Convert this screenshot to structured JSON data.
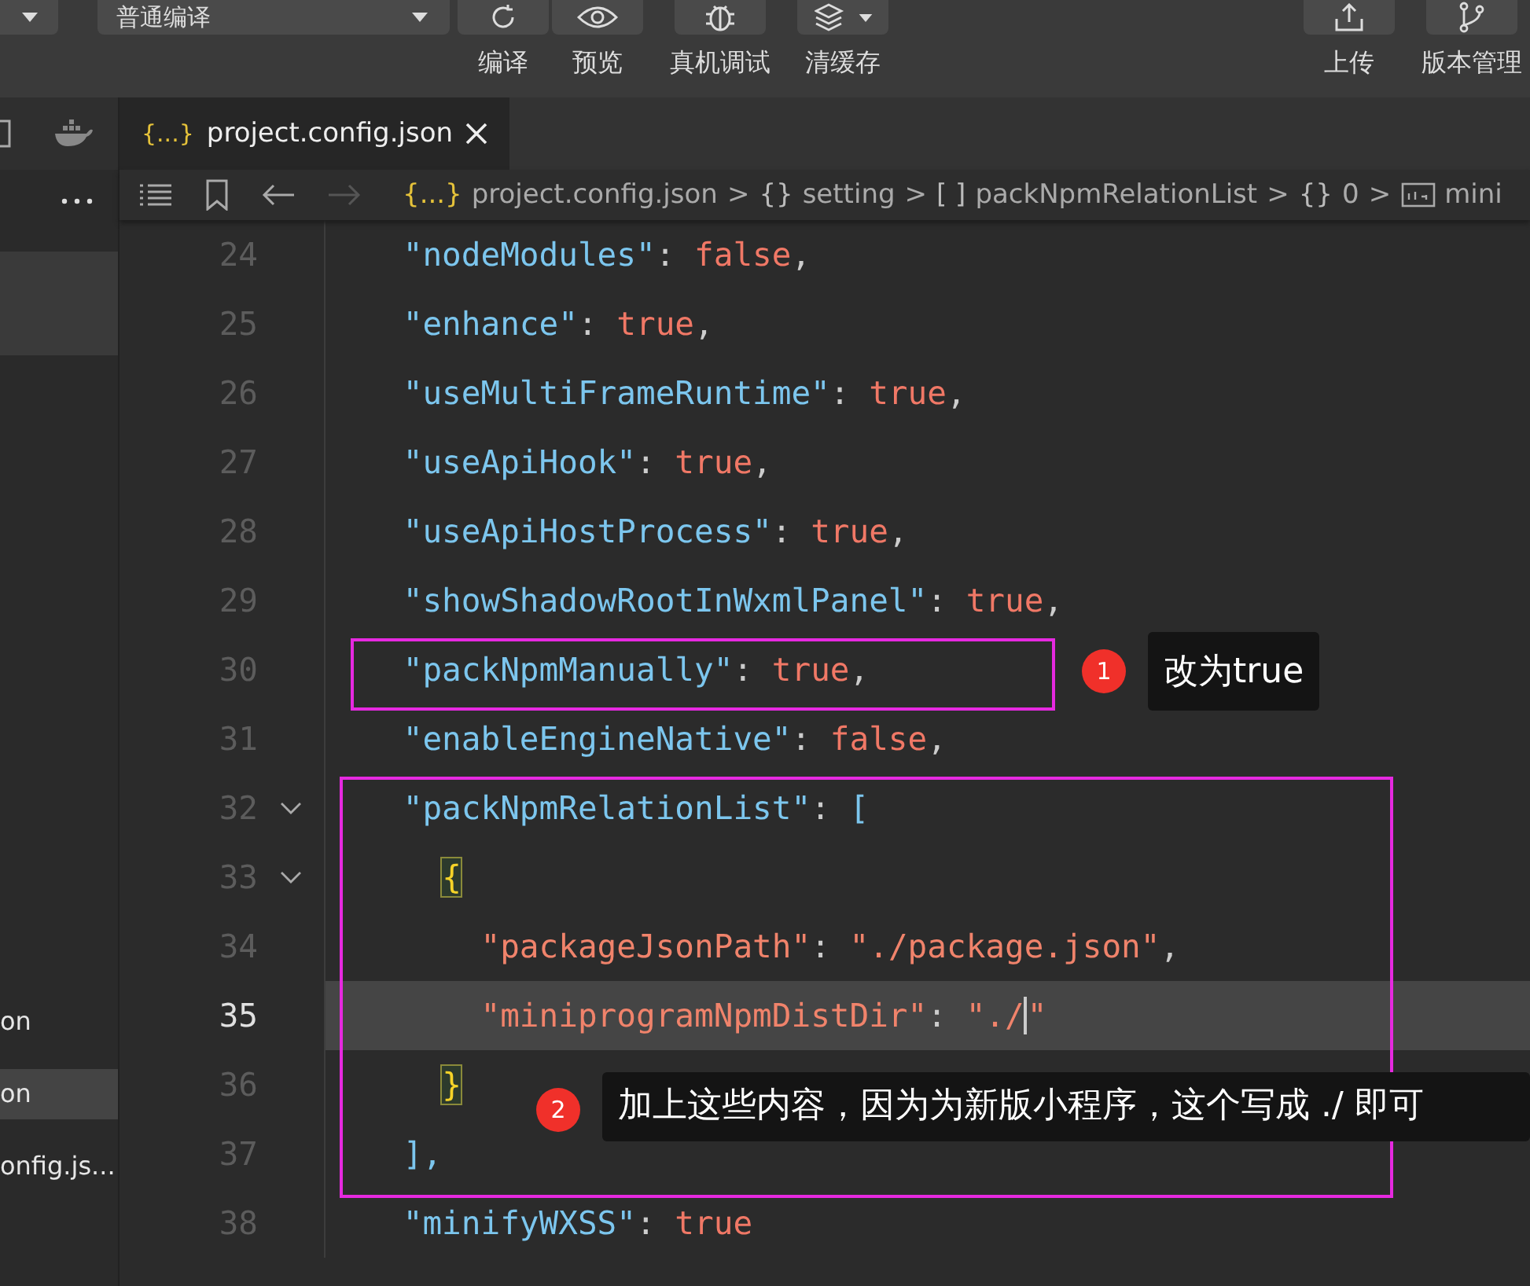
{
  "toolbar": {
    "mode_dropdown": "普通编译",
    "buttons": [
      {
        "label": "编译",
        "has_caret": false
      },
      {
        "label": "预览",
        "has_caret": false
      },
      {
        "label": "真机调试",
        "has_caret": false
      },
      {
        "label": "清缓存",
        "has_caret": true
      }
    ],
    "right_buttons": [
      {
        "label": "上传"
      },
      {
        "label": "版本管理"
      }
    ]
  },
  "sidebar": {
    "items": [
      {
        "label": "on",
        "selected": false
      },
      {
        "label": "on",
        "selected": true
      },
      {
        "label": "onfig.js...",
        "selected": false
      }
    ]
  },
  "tabs": [
    {
      "symbol": "{...}",
      "label": "project.config.json",
      "selected": true
    }
  ],
  "breadcrumb": {
    "separator": ">",
    "items": [
      {
        "symbol": "{...}",
        "label": "project.config.json"
      },
      {
        "symbol": "{}",
        "label": "setting"
      },
      {
        "symbol": "[ ]",
        "label": "packNpmRelationList"
      },
      {
        "symbol": "{}",
        "label": "0"
      },
      {
        "kind": "string",
        "label": "mini"
      }
    ]
  },
  "editor": {
    "lines": [
      {
        "number": "24",
        "current": false,
        "foldable": false,
        "tokens": [
          {
            "text": "    \"nodeModules\"",
            "kind": "key"
          },
          {
            "text": ": ",
            "kind": "punct"
          },
          {
            "text": "false",
            "kind": "bool"
          },
          {
            "text": ",",
            "kind": "punct"
          }
        ]
      },
      {
        "number": "25",
        "current": false,
        "foldable": false,
        "tokens": [
          {
            "text": "    \"enhance\"",
            "kind": "key"
          },
          {
            "text": ": ",
            "kind": "punct"
          },
          {
            "text": "true",
            "kind": "bool"
          },
          {
            "text": ",",
            "kind": "punct"
          }
        ]
      },
      {
        "number": "26",
        "current": false,
        "foldable": false,
        "tokens": [
          {
            "text": "    \"useMultiFrameRuntime\"",
            "kind": "key"
          },
          {
            "text": ": ",
            "kind": "punct"
          },
          {
            "text": "true",
            "kind": "bool"
          },
          {
            "text": ",",
            "kind": "punct"
          }
        ]
      },
      {
        "number": "27",
        "current": false,
        "foldable": false,
        "tokens": [
          {
            "text": "    \"useApiHook\"",
            "kind": "key"
          },
          {
            "text": ": ",
            "kind": "punct"
          },
          {
            "text": "true",
            "kind": "bool"
          },
          {
            "text": ",",
            "kind": "punct"
          }
        ]
      },
      {
        "number": "28",
        "current": false,
        "foldable": false,
        "tokens": [
          {
            "text": "    \"useApiHostProcess\"",
            "kind": "key"
          },
          {
            "text": ": ",
            "kind": "punct"
          },
          {
            "text": "true",
            "kind": "bool"
          },
          {
            "text": ",",
            "kind": "punct"
          }
        ]
      },
      {
        "number": "29",
        "current": false,
        "foldable": false,
        "tokens": [
          {
            "text": "    \"showShadowRootInWxmlPanel\"",
            "kind": "key"
          },
          {
            "text": ": ",
            "kind": "punct"
          },
          {
            "text": "true",
            "kind": "bool"
          },
          {
            "text": ",",
            "kind": "punct"
          }
        ]
      },
      {
        "number": "30",
        "current": false,
        "foldable": false,
        "tokens": [
          {
            "text": "    \"packNpmManually\"",
            "kind": "key"
          },
          {
            "text": ": ",
            "kind": "punct"
          },
          {
            "text": "true",
            "kind": "bool"
          },
          {
            "text": ",",
            "kind": "punct"
          }
        ]
      },
      {
        "number": "31",
        "current": false,
        "foldable": false,
        "tokens": [
          {
            "text": "    \"enableEngineNative\"",
            "kind": "key"
          },
          {
            "text": ": ",
            "kind": "punct"
          },
          {
            "text": "false",
            "kind": "bool"
          },
          {
            "text": ",",
            "kind": "punct"
          }
        ]
      },
      {
        "number": "32",
        "current": false,
        "foldable": true,
        "tokens": [
          {
            "text": "    \"packNpmRelationList\"",
            "kind": "key"
          },
          {
            "text": ": ",
            "kind": "punct"
          },
          {
            "text": "[",
            "kind": "bracket"
          }
        ]
      },
      {
        "number": "33",
        "current": false,
        "foldable": true,
        "tokens": [
          {
            "text": "      {",
            "kind": "brace-match"
          }
        ]
      },
      {
        "number": "34",
        "current": false,
        "foldable": false,
        "tokens": [
          {
            "text": "        \"packageJsonPath\"",
            "kind": "string"
          },
          {
            "text": ": ",
            "kind": "punct"
          },
          {
            "text": "\"./package.json\"",
            "kind": "string"
          },
          {
            "text": ",",
            "kind": "punct"
          }
        ]
      },
      {
        "number": "35",
        "current": true,
        "foldable": false,
        "tokens": [
          {
            "text": "        \"miniprogramNpmDistDir\"",
            "kind": "string"
          },
          {
            "text": ": ",
            "kind": "punct"
          },
          {
            "text": "\"./",
            "kind": "string"
          },
          {
            "text": "\"",
            "kind": "cursor-string"
          }
        ]
      },
      {
        "number": "36",
        "current": false,
        "foldable": false,
        "tokens": [
          {
            "text": "      }",
            "kind": "brace-match"
          }
        ]
      },
      {
        "number": "37",
        "current": false,
        "foldable": false,
        "tokens": [
          {
            "text": "    ],",
            "kind": "bracket"
          }
        ]
      },
      {
        "number": "38",
        "current": false,
        "foldable": false,
        "tokens": [
          {
            "text": "    \"minifyWXSS\"",
            "kind": "key"
          },
          {
            "text": ": ",
            "kind": "punct"
          },
          {
            "text": "true",
            "kind": "bool"
          }
        ]
      }
    ]
  },
  "annotations": [
    {
      "number": "1",
      "text": "改为true"
    },
    {
      "number": "2",
      "text": "加上这些内容，因为为新版小程序，这个写成 ./  即可"
    }
  ]
}
